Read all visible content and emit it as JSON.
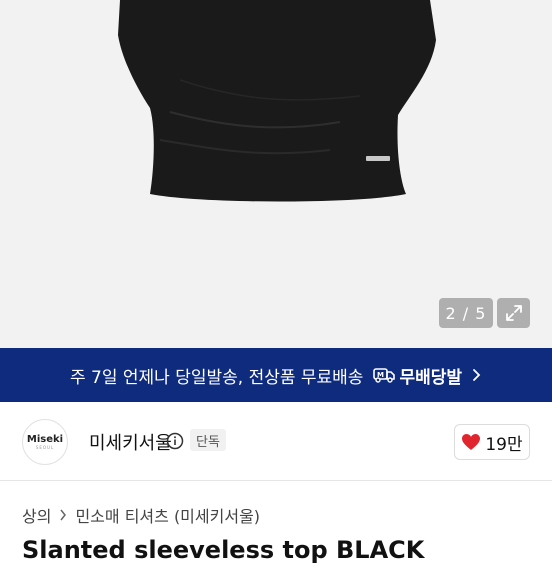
{
  "gallery": {
    "current": "2",
    "separator": "/",
    "total": "5",
    "counter_text": "2 / 5"
  },
  "banner": {
    "text": "주 7일 언제나 당일발송, 전상품 무료배송",
    "free_label": "무배당발"
  },
  "brand": {
    "logo_text": "Miseki",
    "logo_sub": "SEOUL",
    "name": "미세키서울",
    "badge": "단독",
    "likes": "19만"
  },
  "breadcrumb": {
    "items": [
      "상의",
      "민소매 티셔츠 (미세키서울)"
    ]
  },
  "product": {
    "title": "Slanted sleeveless top BLACK"
  },
  "colors": {
    "banner_bg": "#0f2b7e",
    "heart": "#e0252f",
    "hero_bg": "#f2f2f2"
  }
}
